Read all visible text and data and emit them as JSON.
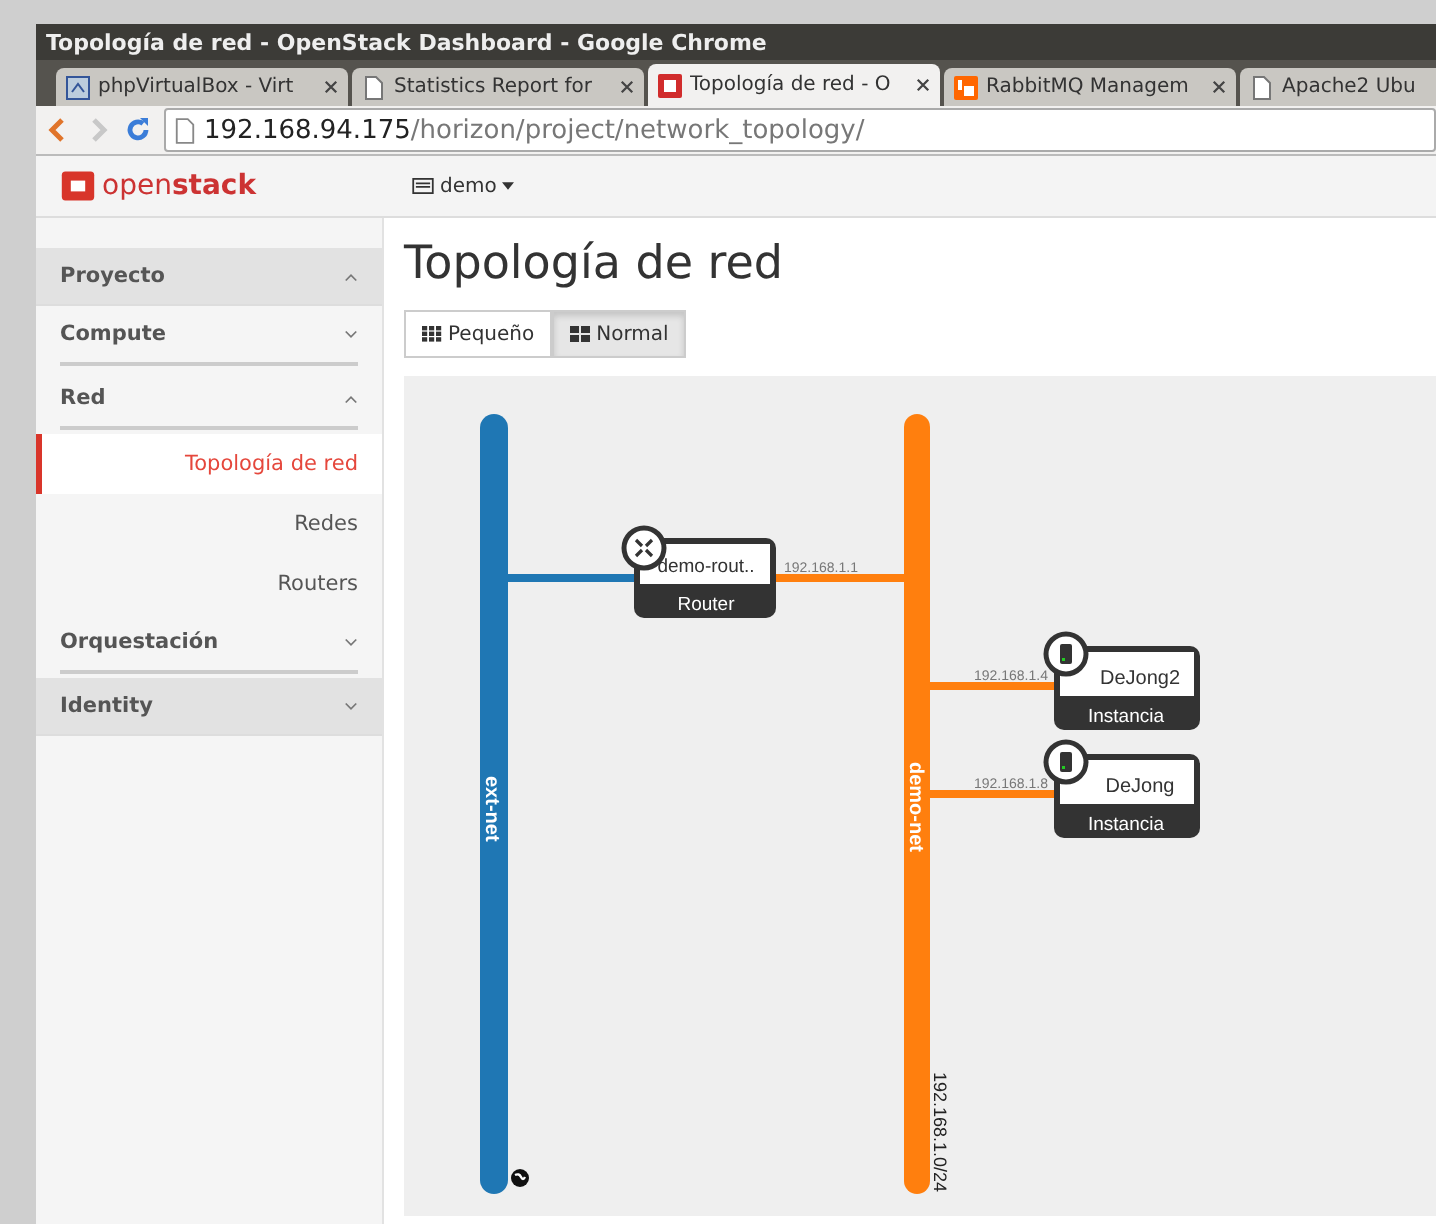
{
  "window": {
    "title": "Topología de red - OpenStack Dashboard - Google Chrome"
  },
  "tabs": [
    {
      "label": "phpVirtualBox - Virt",
      "selected": false
    },
    {
      "label": "Statistics Report for",
      "selected": false
    },
    {
      "label": "Topología de red - O",
      "selected": true
    },
    {
      "label": "RabbitMQ Managem",
      "selected": false
    },
    {
      "label": "Apache2 Ubu",
      "selected": false
    }
  ],
  "address_bar": {
    "host": "192.168.94.175",
    "path": "/horizon/project/network_topology/"
  },
  "header": {
    "brand_light": "open",
    "brand_bold": "stack",
    "project": "demo"
  },
  "sidebar": {
    "items": [
      {
        "label": "Proyecto",
        "expanded": true,
        "children": [
          {
            "label": "Compute",
            "expanded": false
          },
          {
            "label": "Red",
            "expanded": true,
            "children": [
              {
                "label": "Topología de red",
                "selected": true
              },
              {
                "label": "Redes",
                "selected": false
              },
              {
                "label": "Routers",
                "selected": false
              }
            ]
          },
          {
            "label": "Orquestación",
            "expanded": false
          }
        ]
      },
      {
        "label": "Identity",
        "expanded": false
      }
    ]
  },
  "page_title": "Topología de red",
  "view_buttons": [
    {
      "label": "Pequeño",
      "selected": false
    },
    {
      "label": "Normal",
      "selected": true
    }
  ],
  "topology": {
    "networks": [
      {
        "name": "ext-net",
        "color": "#1f77b4"
      },
      {
        "name": "demo-net",
        "color": "#ff7f0e",
        "subnet": "192.168.1.0/24"
      }
    ],
    "router": {
      "name": "demo-rout..",
      "type": "Router",
      "ip": "192.168.1.1"
    },
    "instances": [
      {
        "name": "DeJong2",
        "type": "Instancia",
        "ip": "192.168.1.4"
      },
      {
        "name": "DeJong",
        "type": "Instancia",
        "ip": "192.168.1.8"
      }
    ]
  }
}
